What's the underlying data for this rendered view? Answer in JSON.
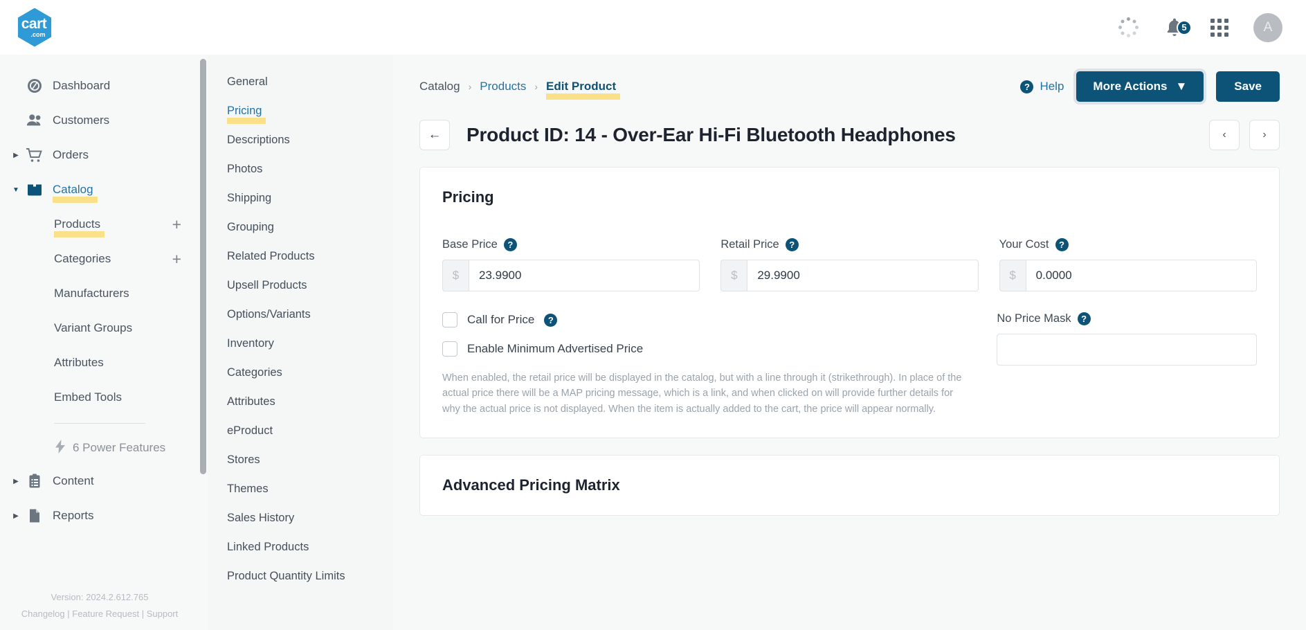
{
  "header": {
    "logo_main": "cart",
    "logo_sub": ".com",
    "notification_count": "5",
    "avatar_initial": "A",
    "icons": [
      "loading-spinner-icon",
      "bell-icon",
      "apps-grid-icon",
      "avatar"
    ]
  },
  "sidebar": {
    "items": [
      {
        "label": "Dashboard",
        "icon": "dashboard-icon",
        "expandable": false,
        "active": false
      },
      {
        "label": "Customers",
        "icon": "customers-icon",
        "expandable": false,
        "active": false
      },
      {
        "label": "Orders",
        "icon": "orders-cart-icon",
        "expandable": true,
        "active": false
      },
      {
        "label": "Catalog",
        "icon": "catalog-box-icon",
        "expandable": true,
        "active": true
      },
      {
        "label": "Content",
        "icon": "content-clipboard-icon",
        "expandable": true,
        "active": false
      },
      {
        "label": "Reports",
        "icon": "reports-document-icon",
        "expandable": true,
        "active": false
      }
    ],
    "catalog_children": [
      {
        "label": "Products",
        "add": "+",
        "highlighted": true
      },
      {
        "label": "Categories",
        "add": "+",
        "highlighted": false
      },
      {
        "label": "Manufacturers",
        "add": "",
        "highlighted": false
      },
      {
        "label": "Variant Groups",
        "add": "",
        "highlighted": false
      },
      {
        "label": "Attributes",
        "add": "",
        "highlighted": false
      },
      {
        "label": "Embed Tools",
        "add": "",
        "highlighted": false
      }
    ],
    "power_features": "6 Power Features",
    "version": "Version: 2024.2.612.765",
    "footer_links": [
      "Changelog",
      "Feature Request",
      "Support"
    ],
    "footer_separator": " | "
  },
  "subnav": {
    "items": [
      {
        "label": "General",
        "active": false
      },
      {
        "label": "Pricing",
        "active": true
      },
      {
        "label": "Descriptions",
        "active": false
      },
      {
        "label": "Photos",
        "active": false
      },
      {
        "label": "Shipping",
        "active": false
      },
      {
        "label": "Grouping",
        "active": false
      },
      {
        "label": "Related Products",
        "active": false
      },
      {
        "label": "Upsell Products",
        "active": false
      },
      {
        "label": "Options/Variants",
        "active": false
      },
      {
        "label": "Inventory",
        "active": false
      },
      {
        "label": "Categories",
        "active": false
      },
      {
        "label": "Attributes",
        "active": false
      },
      {
        "label": "eProduct",
        "active": false
      },
      {
        "label": "Stores",
        "active": false
      },
      {
        "label": "Themes",
        "active": false
      },
      {
        "label": "Sales History",
        "active": false
      },
      {
        "label": "Linked Products",
        "active": false
      },
      {
        "label": "Product Quantity Limits",
        "active": false
      }
    ]
  },
  "breadcrumb": {
    "items": [
      "Catalog",
      "Products",
      "Edit Product"
    ],
    "separator": "›"
  },
  "actions": {
    "help_label": "Help",
    "help_icon_glyph": "?",
    "more_actions_label": "More Actions",
    "save_label": "Save",
    "back_arrow": "←",
    "prev_arrow": "‹",
    "next_arrow": "›"
  },
  "page": {
    "title": "Product ID: 14 - Over-Ear Hi-Fi Bluetooth Headphones"
  },
  "pricing_card": {
    "title": "Pricing",
    "currency_symbol": "$",
    "base_price": {
      "label": "Base Price",
      "value": "23.9900",
      "help": "?"
    },
    "retail_price": {
      "label": "Retail Price",
      "value": "29.9900",
      "help": "?"
    },
    "your_cost": {
      "label": "Your Cost",
      "value": "0.0000",
      "help": "?"
    },
    "no_price_mask": {
      "label": "No Price Mask",
      "value": "",
      "placeholder": "",
      "help": "?"
    },
    "call_for_price": {
      "label": "Call for Price",
      "checked": false,
      "help": "?"
    },
    "enable_map": {
      "label": "Enable Minimum Advertised Price",
      "checked": false
    },
    "map_note": "When enabled, the retail price will be displayed in the catalog, but with a line through it (strikethrough). In place of the actual price there will be a MAP pricing message, which is a link, and when clicked on will provide further details for why the actual price is not displayed. When the item is actually added to the cart, the price will appear normally."
  },
  "advanced_card": {
    "title": "Advanced Pricing Matrix"
  },
  "colors": {
    "brand_blue": "#2e9bd6",
    "navy": "#0d5377",
    "link_blue": "#2273a5",
    "highlight_yellow": "#fbe08a"
  }
}
